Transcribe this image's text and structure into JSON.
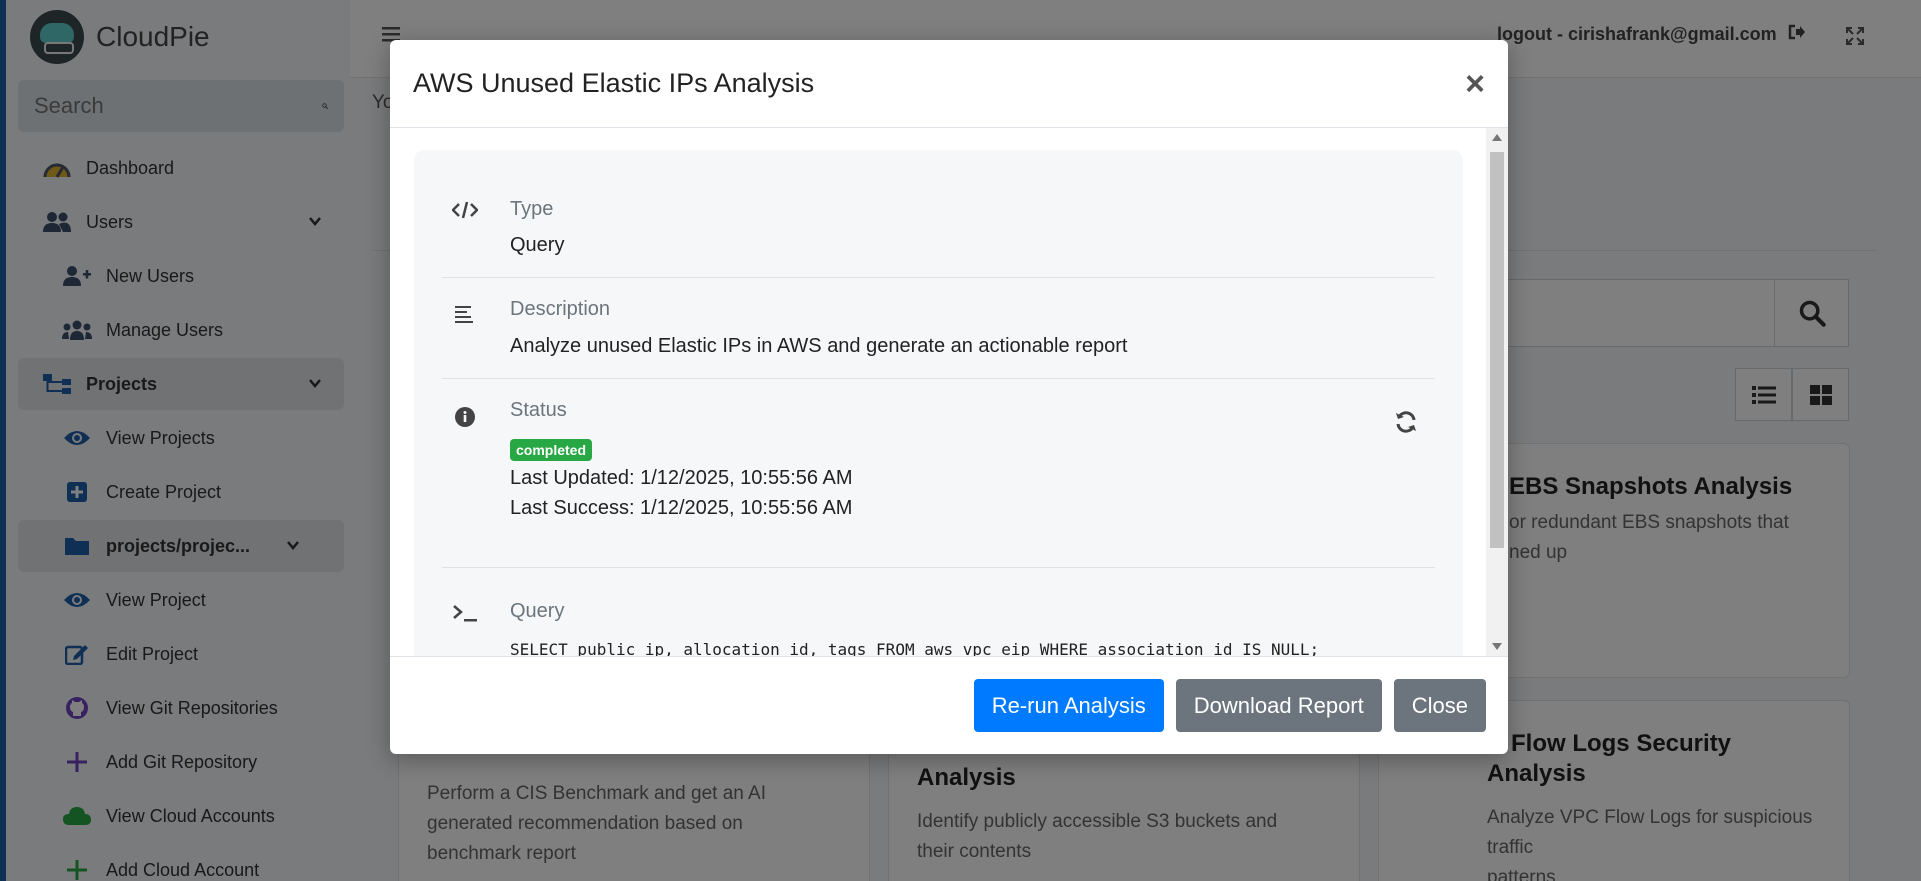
{
  "brand": {
    "name": "CloudPie"
  },
  "search": {
    "placeholder": "Search"
  },
  "sidebar": {
    "items": [
      {
        "label": "Dashboard",
        "icon": "dashboard-icon"
      },
      {
        "label": "Users",
        "icon": "users-icon"
      },
      {
        "label": "New Users",
        "icon": "user-plus-icon"
      },
      {
        "label": "Manage Users",
        "icon": "users-group-icon"
      },
      {
        "label": "Projects",
        "icon": "sitemap-icon"
      },
      {
        "label": "View Projects",
        "icon": "eye-icon"
      },
      {
        "label": "Create Project",
        "icon": "plus-square-icon"
      },
      {
        "label": "projects/projec...",
        "icon": "folder-icon"
      },
      {
        "label": "View Project",
        "icon": "eye-icon"
      },
      {
        "label": "Edit Project",
        "icon": "edit-icon"
      },
      {
        "label": "View Git Repositories",
        "icon": "github-icon"
      },
      {
        "label": "Add Git Repository",
        "icon": "plus-icon"
      },
      {
        "label": "View Cloud Accounts",
        "icon": "cloud-icon"
      },
      {
        "label": "Add Cloud Account",
        "icon": "plus-icon"
      }
    ]
  },
  "header": {
    "logout": "logout - cirishafrank@gmail.com"
  },
  "background": {
    "you_text": "Yo",
    "cards": [
      {
        "title": "EBS Snapshots Analysis",
        "desc_line1": "or redundant EBS snapshots that",
        "desc_line2": "ned up"
      },
      {
        "title": "",
        "desc_line1": "Perform a CIS Benchmark and get an AI",
        "desc_line2": "generated recommendation based on",
        "desc_line3": "benchmark report"
      },
      {
        "title": "Analysis",
        "desc_line1": "Identify publicly accessible S3 buckets and",
        "desc_line2": "their contents"
      },
      {
        "title_line1": "C Flow Logs Security",
        "title_line2": "Analysis",
        "desc_line1": "Analyze VPC Flow Logs for suspicious traffic",
        "desc_line2": "patterns"
      }
    ]
  },
  "modal": {
    "title": "AWS Unused Elastic IPs Analysis",
    "close_symbol": "×",
    "type_label": "Type",
    "type_value": "Query",
    "description_label": "Description",
    "description_value": "Analyze unused Elastic IPs in AWS and generate an actionable report",
    "status_label": "Status",
    "status_badge": "completed",
    "last_updated": "Last Updated: 1/12/2025, 10:55:56 AM",
    "last_success": "Last Success: 1/12/2025, 10:55:56 AM",
    "query_label": "Query",
    "query_value": "SELECT public_ip, allocation_id, tags FROM aws_vpc_eip WHERE association_id IS NULL;",
    "buttons": {
      "rerun": "Re-run Analysis",
      "download": "Download Report",
      "close": "Close"
    }
  },
  "colors": {
    "primary": "#007bff",
    "secondary": "#6c757d",
    "success": "#28a745",
    "sidebar_accent": "#1f5fa8"
  }
}
